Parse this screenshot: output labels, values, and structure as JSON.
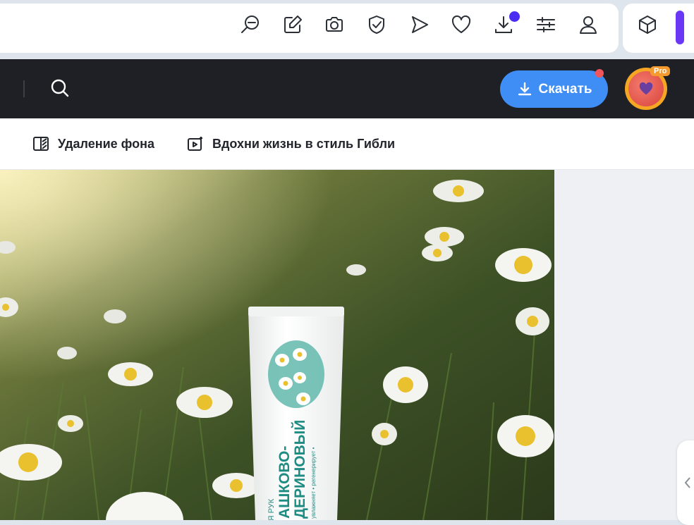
{
  "browser_toolbar": {
    "icons": [
      "zoom-out-icon",
      "edit-icon",
      "camera-icon",
      "shield-icon",
      "send-icon",
      "heart-icon",
      "download-icon",
      "sliders-icon",
      "profile-icon"
    ],
    "extensions": [
      "cube-icon"
    ],
    "download_badge_color": "#4b2cf2",
    "accent_color": "#6a38f5"
  },
  "header": {
    "download_button": "Скачать",
    "pro_badge": "Pro",
    "accent_color": "#3e8ef5",
    "background": "#1e2026"
  },
  "tools": {
    "remove_bg": "Удаление фона",
    "ghibli": "Вдохни жизнь в стиль Гибли"
  },
  "image": {
    "tube_lines": [
      "ДЛЯ РУК",
      "АШКОВО-",
      "ДЕРИНОВЫЙ"
    ],
    "tube_small": "увлажняет • регенерирует •",
    "tube_small2": "ет • регенерирует •"
  }
}
